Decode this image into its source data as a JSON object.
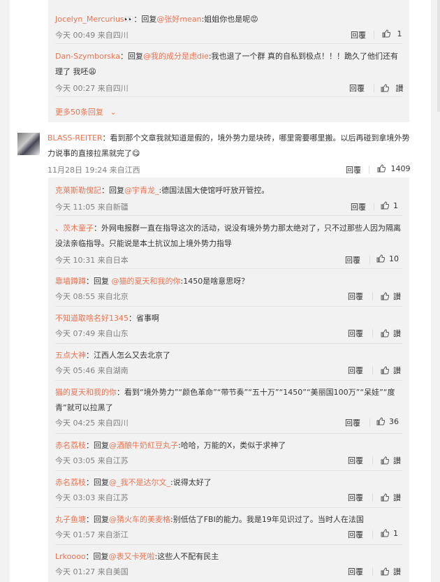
{
  "top_thread": [
    {
      "user": "Jocelyn_Mercurius",
      "badge": "👀",
      "prefix": "：回复",
      "mention": "@张好mean",
      "text": ":姐姐你也是呢",
      "time": "今天 00:49 来自四川",
      "reply": "回覆",
      "likes": "1",
      "emoji": "😡"
    },
    {
      "user": "Dan-Szymborska",
      "prefix": "：回复",
      "mention": "@我的成分是虑die",
      "text": ":我也退了一个群 真的自私到极点！！！跪久了他们还有理了 我呸",
      "time": "今天 00:27 来自四川",
      "reply": "回覆",
      "likes": "讃",
      "emoji": "😩"
    }
  ],
  "more_replies": "更多50条回复",
  "main_comment": {
    "user": "BLASS-REITER",
    "text": "：看到那个文章我就知道是假的，境外势力是块砖，哪里需要哪里搬。以后再碰到拿境外势力说事的直接拉黑就完了",
    "time": "11月28日 19:24 来自江西",
    "reply": "回覆",
    "likes": "1409",
    "emoji": "😋"
  },
  "replies": [
    {
      "user": "克萊斯勒傀記",
      "prefix": "：回复",
      "mention": "@宇青龙_",
      "text": ":德国法国大使馆呼吁放开管控。",
      "time": "今天 11:05 来自新疆",
      "reply": "回覆",
      "likes": "1"
    },
    {
      "user": "、茨木童子",
      "prefix": "",
      "mention": "",
      "text": "：外网电报群一直在指导这次的活动，说没有境外势力那太绝对了，只不过那些人因为隔离没法亲临指导。只能说是本土抗议加上境外势力指导",
      "time": "今天 10:31 来自日本",
      "reply": "回覆",
      "likes": "10"
    },
    {
      "user": "靠墙蹲蹲",
      "prefix": "：回复 ",
      "mention": "@猫的夏天和我的你",
      "text": ":1450是啥意思呀？",
      "time": "今天 08:55 来自北京",
      "reply": "回覆",
      "likes": "讃"
    },
    {
      "user": "不知道取啥名好1345",
      "prefix": "",
      "mention": "",
      "text": "：省事啊",
      "time": "今天 07:49 来自山东",
      "reply": "回覆",
      "likes": "讃"
    },
    {
      "user": "五点大神",
      "prefix": "",
      "mention": "",
      "text": "：江西人怎么又去北京了",
      "time": "今天 05:46 来自湖南",
      "reply": "回覆",
      "likes": "讃"
    },
    {
      "user": "猫的夏天和我的你",
      "prefix": "",
      "mention": "",
      "text": "：看到“境外势力”“颜色革命”“带节奏”“五十万”“1450”“美丽国100万”“呆娃”“度青”就可以拉黑了",
      "time": "今天 04:25 来自四川",
      "reply": "回覆",
      "likes": "36"
    },
    {
      "user": "赤名荔枝",
      "prefix": "：回复",
      "mention": "@酒酿牛奶紅豆丸子",
      "text": ":哈哈，万能的X，类似于求神了",
      "time": "今天 03:05 来自江苏",
      "reply": "回覆",
      "likes": "讃"
    },
    {
      "user": "赤名荔枝",
      "prefix": "：回复",
      "mention": "@_我不是达尔文_",
      "text": ":说得太好了",
      "time": "今天 03:03 来自江苏",
      "reply": "回覆",
      "likes": "讃"
    },
    {
      "user": "丸子鱼塘",
      "prefix": "：回复",
      "mention": "@猜火车的美麦格",
      "text": ":别低估了FBI的能力。我是19年见识过了。当时人在法国",
      "time": "今天 01:57 来自浙江",
      "reply": "回覆",
      "likes": "1"
    },
    {
      "user": "Lrkoooo",
      "prefix": "：回复",
      "mention": "@表又卡死啦",
      "text": ":这些人不配有民主",
      "time": "今天 01:27 来自美国",
      "reply": "回覆",
      "likes": "讃"
    }
  ],
  "colors": {
    "accent": "#eb7350",
    "bg": "#f2f2f2",
    "text": "#333333",
    "meta": "#808080"
  }
}
